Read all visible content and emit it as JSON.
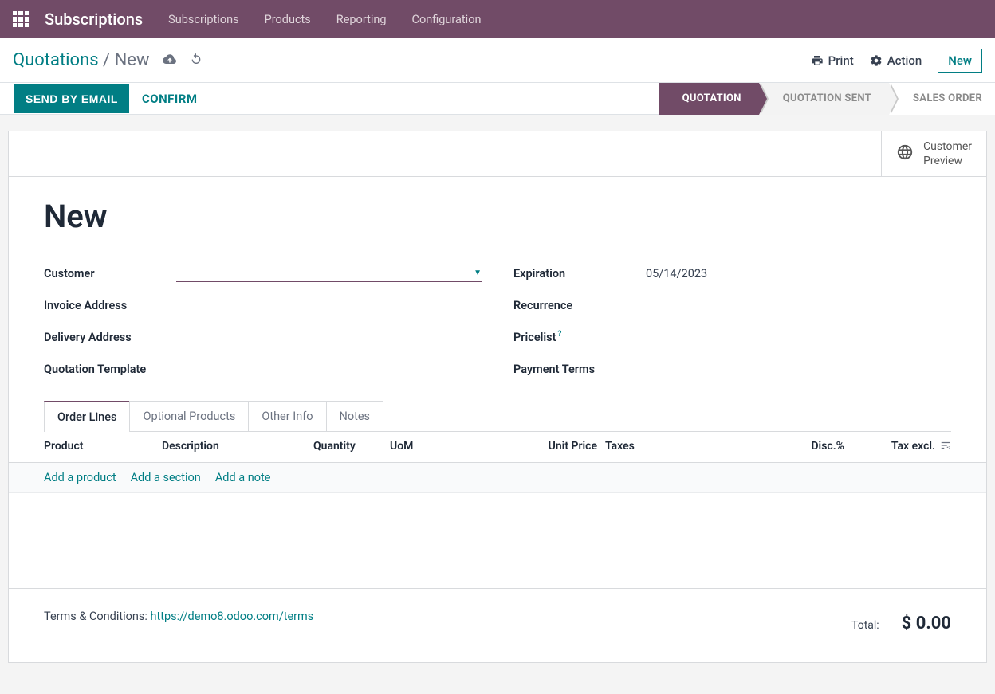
{
  "topnav": {
    "app_name": "Subscriptions",
    "items": [
      "Subscriptions",
      "Products",
      "Reporting",
      "Configuration"
    ]
  },
  "breadcrumb": {
    "parent": "Quotations",
    "current": "New",
    "print": "Print",
    "action": "Action",
    "new": "New"
  },
  "actionbar": {
    "send_email": "SEND BY EMAIL",
    "confirm": "CONFIRM",
    "stages": {
      "quotation": "QUOTATION",
      "sent": "QUOTATION SENT",
      "order": "SALES ORDER"
    }
  },
  "preview": {
    "line1": "Customer",
    "line2": "Preview"
  },
  "form": {
    "title": "New",
    "left": {
      "customer": "Customer",
      "invoice_addr": "Invoice Address",
      "delivery_addr": "Delivery Address",
      "template": "Quotation Template"
    },
    "right": {
      "expiration_label": "Expiration",
      "expiration_value": "05/14/2023",
      "recurrence": "Recurrence",
      "pricelist": "Pricelist",
      "payment_terms": "Payment Terms"
    }
  },
  "tabs": {
    "order_lines": "Order Lines",
    "optional": "Optional Products",
    "other": "Other Info",
    "notes": "Notes"
  },
  "table": {
    "headers": {
      "product": "Product",
      "description": "Description",
      "quantity": "Quantity",
      "uom": "UoM",
      "unit_price": "Unit Price",
      "taxes": "Taxes",
      "disc": "Disc.%",
      "tax_excl": "Tax excl."
    },
    "actions": {
      "add_product": "Add a product",
      "add_section": "Add a section",
      "add_note": "Add a note"
    }
  },
  "footer": {
    "terms_label": "Terms & Conditions: ",
    "terms_link": "https://demo8.odoo.com/terms",
    "total_label": "Total:",
    "total_value": "$ 0.00"
  }
}
